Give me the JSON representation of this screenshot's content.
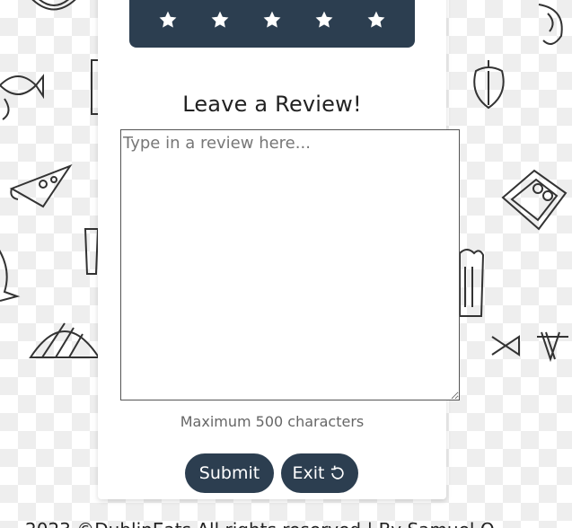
{
  "rating": {
    "star_count": 5,
    "star_color": "#ffffff",
    "bar_color": "#2c3e50"
  },
  "review": {
    "title": "Leave a Review!",
    "placeholder": "Type in a review here...",
    "value": "",
    "max_chars_note": "Maximum 500 characters"
  },
  "actions": {
    "submit_label": "Submit",
    "exit_label": "Exit",
    "button_color": "#2c3e50"
  },
  "footer": {
    "text": "2023 ©DublinEats All rights reserved | By Samuel O"
  },
  "icons": {
    "star": "star-icon",
    "exit": "rotate-left-icon"
  }
}
